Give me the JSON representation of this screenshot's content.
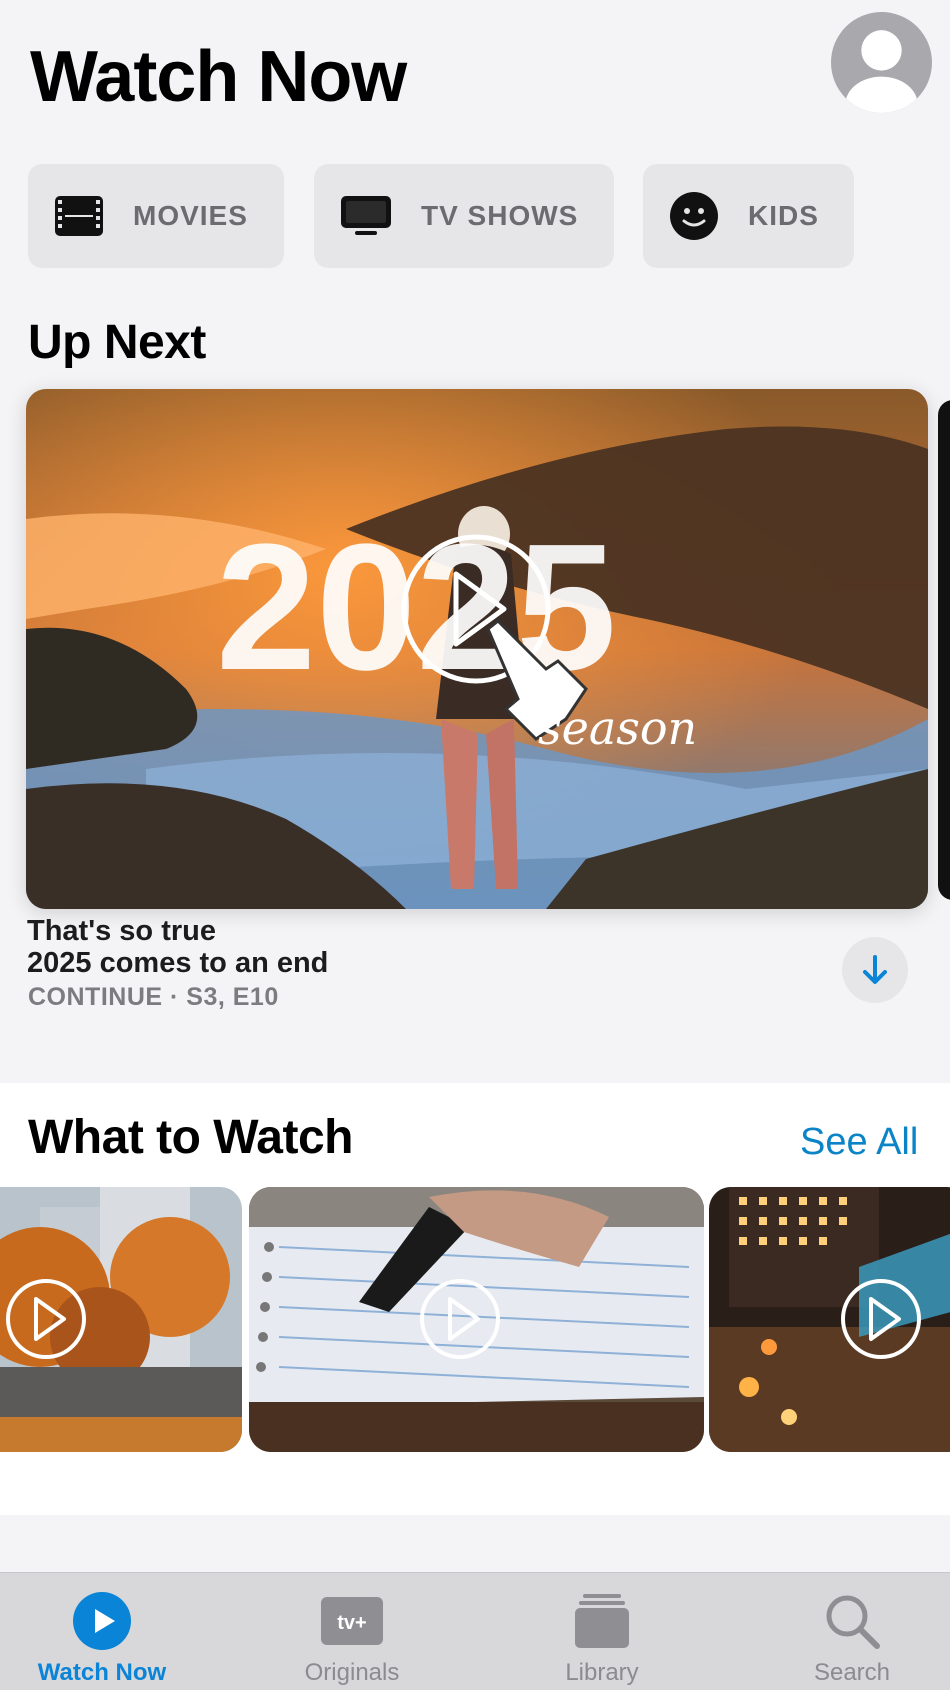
{
  "header": {
    "title": "Watch Now"
  },
  "categories": [
    {
      "label": "MOVIES",
      "icon": "film-icon"
    },
    {
      "label": "TV SHOWS",
      "icon": "tv-icon"
    },
    {
      "label": "KIDS",
      "icon": "smiley-icon"
    }
  ],
  "up_next": {
    "heading": "Up Next",
    "hero_overlay": {
      "year": "2025",
      "script": "season"
    },
    "show": "That's so true",
    "episode": "2025 comes to an end",
    "meta": "CONTINUE · S3, E10"
  },
  "what_to_watch": {
    "heading": "What to Watch",
    "see_all": "See All"
  },
  "tab_bar": {
    "tabs": [
      {
        "label": "Watch Now",
        "active": true
      },
      {
        "label": "Originals",
        "active": false
      },
      {
        "label": "Library",
        "active": false
      },
      {
        "label": "Search",
        "active": false
      }
    ],
    "originals_logo": "tv+"
  },
  "colors": {
    "accent": "#0a84d6",
    "link": "#0a84c6"
  }
}
